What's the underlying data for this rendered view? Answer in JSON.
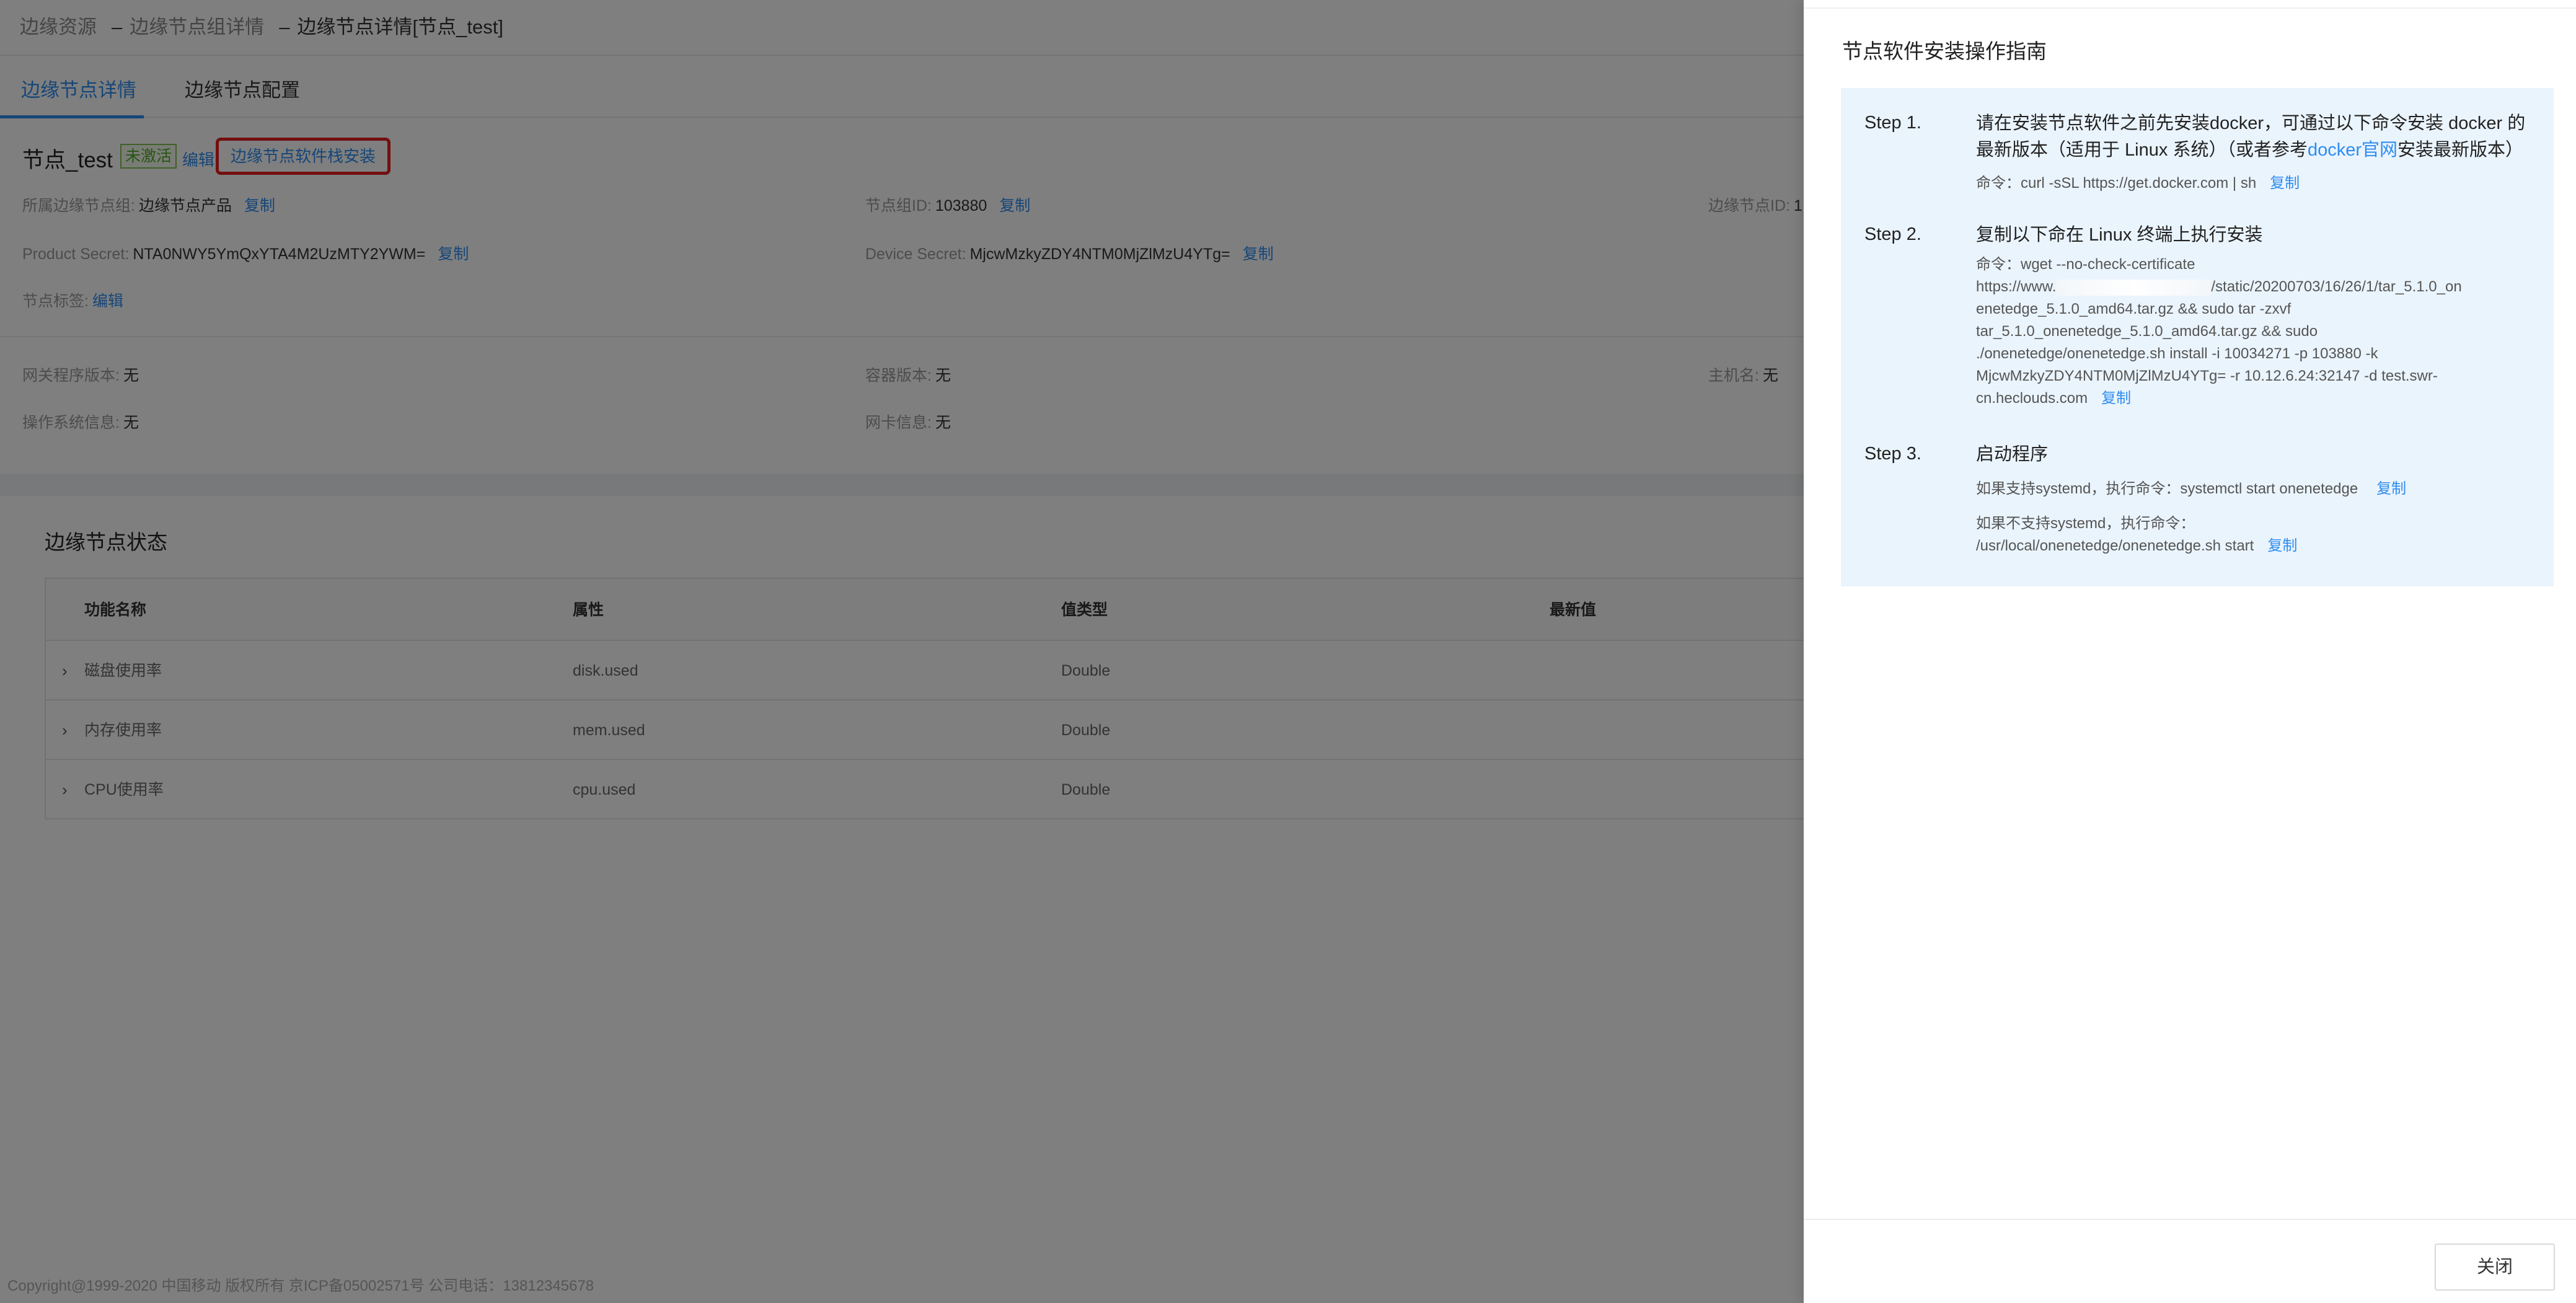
{
  "breadcrumb": {
    "items": [
      "边缘资源",
      "边缘节点组详情",
      "边缘节点详情[节点_test]"
    ],
    "separator": "–"
  },
  "tabs": [
    {
      "label": "边缘节点详情",
      "active": true
    },
    {
      "label": "边缘节点配置",
      "active": false
    }
  ],
  "node": {
    "name": "节点_test",
    "status": "未激活",
    "edit_label": "编辑",
    "install_label": "边缘节点软件栈安装"
  },
  "info": {
    "group_label": "所属边缘节点组:",
    "group_value": "边缘节点产品",
    "group_id_label": "节点组ID:",
    "group_id_value": "103880",
    "node_id_label": "边缘节点ID:",
    "node_id_value": "1",
    "product_secret_label": "Product Secret:",
    "product_secret_value": "NTA0NWY5YmQxYTA4M2UzMTY2YWM=",
    "device_secret_label": "Device Secret:",
    "device_secret_value": "MjcwMzkyZDY4NTM0MjZlMzU4YTg=",
    "tags_label": "节点标签:",
    "tags_edit": "编辑",
    "copy_label": "复制"
  },
  "runtime": {
    "gateway_label": "网关程序版本:",
    "gateway_value": "无",
    "container_label": "容器版本:",
    "container_value": "无",
    "host_label": "主机名:",
    "host_value": "无",
    "os_label": "操作系统信息:",
    "os_value": "无",
    "nic_label": "网卡信息:",
    "nic_value": "无"
  },
  "status_section": {
    "title": "边缘节点状态",
    "columns": [
      "功能名称",
      "属性",
      "值类型",
      "最新值"
    ],
    "rows": [
      {
        "name": "磁盘使用率",
        "attr": "disk.used",
        "type": "Double",
        "latest": ""
      },
      {
        "name": "内存使用率",
        "attr": "mem.used",
        "type": "Double",
        "latest": ""
      },
      {
        "name": "CPU使用率",
        "attr": "cpu.used",
        "type": "Double",
        "latest": ""
      }
    ]
  },
  "footer": {
    "text": "Copyright@1999-2020 中国移动 版权所有 京ICP备05002571号 公司电话：13812345678"
  },
  "drawer": {
    "title": "节点软件安装操作指南",
    "steps": [
      {
        "label": "Step 1.",
        "head_line1": "请在安装节点软件之前先安装docker，可通过以下命令安装 docker 的",
        "head_line2_pre": "最新版本（适用于 Linux 系统）（或者参考",
        "head_link": "docker官网",
        "head_line2_post": "安装最新版本）",
        "cmd": "命令：curl -sSL https://get.docker.com | sh",
        "copy": "复制"
      },
      {
        "label": "Step 2.",
        "head": "复制以下命在 Linux 终端上执行安装",
        "cmd_line1": "命令：wget --no-check-certificate",
        "cmd_line2_pre": "https://www.",
        "cmd_line2_post": "/static/20200703/16/26/1/tar_5.1.0_on",
        "cmd_line3": "enetedge_5.1.0_amd64.tar.gz && sudo tar -zxvf",
        "cmd_line4": "tar_5.1.0_onenetedge_5.1.0_amd64.tar.gz && sudo",
        "cmd_line5": "./onenetedge/onenetedge.sh install -i 10034271 -p 103880 -k",
        "cmd_line6": "MjcwMzkyZDY4NTM0MjZlMzU4YTg= -r 10.12.6.24:32147 -d test.swr-",
        "cmd_line7": "cn.heclouds.com",
        "copy": "复制"
      },
      {
        "label": "Step 3.",
        "head": "启动程序",
        "cmd_a": "如果支持systemd，执行命令：systemctl start onenetedge",
        "cmd_b_line1": "如果不支持systemd，执行命令：",
        "cmd_b_line2": "/usr/local/onenetedge/onenetedge.sh start",
        "copy": "复制"
      }
    ],
    "close_label": "关闭"
  }
}
